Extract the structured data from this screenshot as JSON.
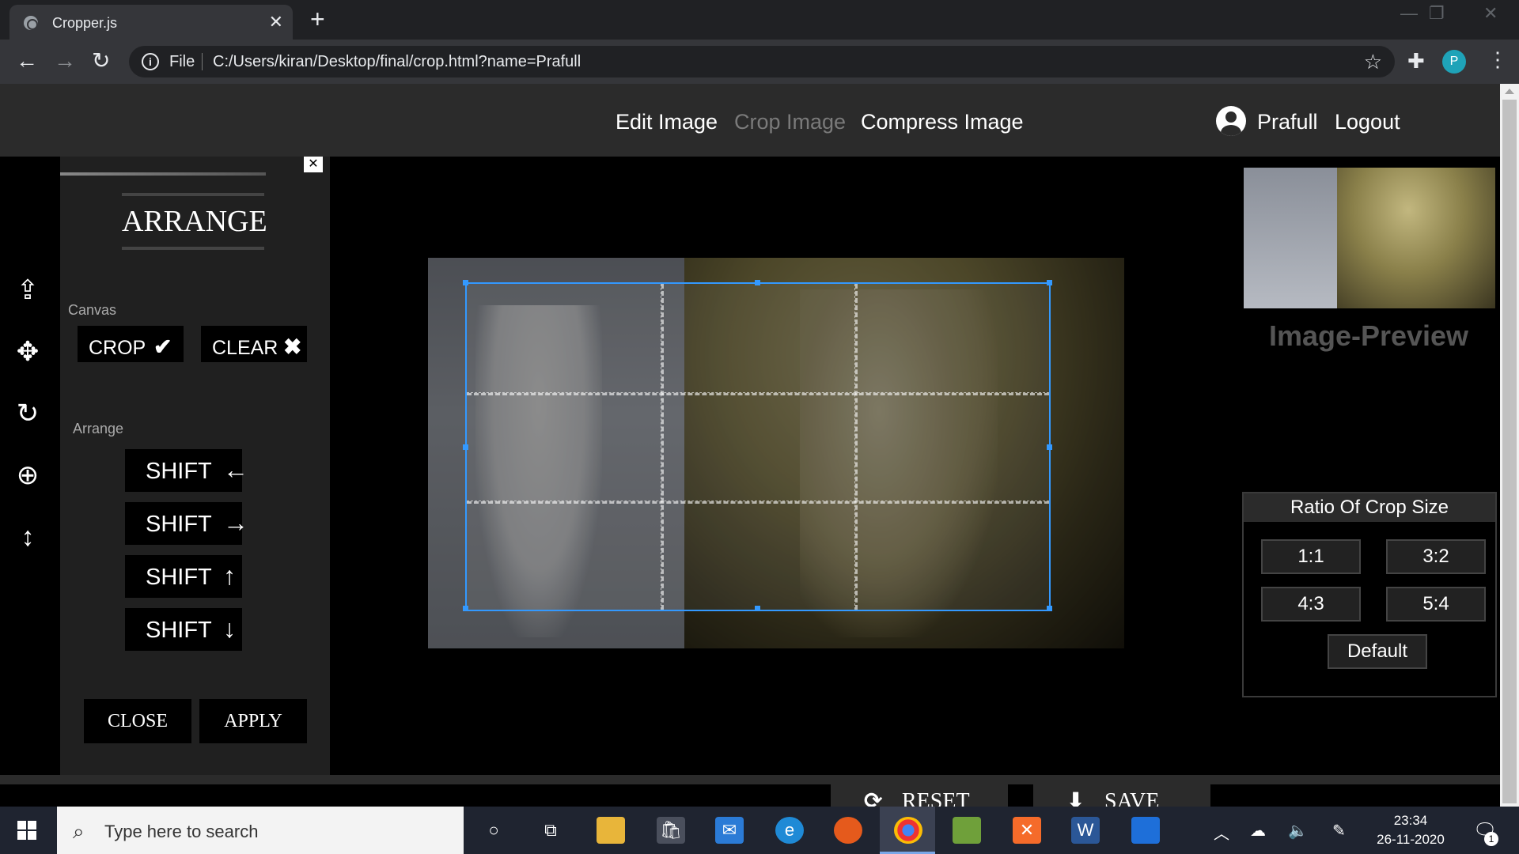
{
  "browser": {
    "tab_title": "Cropper.js",
    "tab_close": "✕",
    "new_tab": "+",
    "address_scheme": "File",
    "address_url": "C:/Users/kiran/Desktop/final/crop.html?name=Prafull",
    "profile_initial": "P",
    "window_controls": [
      "—",
      "❐",
      "✕"
    ]
  },
  "navbar": {
    "links": [
      "Edit Image",
      "Crop Image",
      "Compress Image"
    ],
    "user_name": "Prafull",
    "logout": "Logout"
  },
  "arrange_panel": {
    "heading": "ARRANGE",
    "canvas_label": "Canvas",
    "crop_button": "CROP",
    "clear_button": "CLEAR",
    "arrange_label": "Arrange",
    "shift_buttons": [
      "SHIFT",
      "SHIFT",
      "SHIFT",
      "SHIFT"
    ],
    "close_button": "CLOSE",
    "apply_button": "APPLY"
  },
  "preview_panel": {
    "title": "Image-Preview",
    "ratio_heading": "Ratio Of Crop Size",
    "ratios": [
      "1:1",
      "3:2",
      "4:3",
      "5:4"
    ],
    "default_button": "Default"
  },
  "actions": {
    "reset": "RESET",
    "save": "SAVE"
  },
  "taskbar": {
    "search_placeholder": "Type here to search",
    "time": "23:34",
    "date": "26-11-2020",
    "notification_count": "1"
  },
  "icons": {
    "left_toolbar": [
      "upload-icon",
      "move-icon",
      "rotate-icon",
      "zoom-in-icon",
      "flip-vertical-icon"
    ]
  },
  "colors": {
    "crop_accent": "#3399ff",
    "navbar_bg": "#2b2b2b",
    "disabled_link": "#7a7a7a"
  }
}
